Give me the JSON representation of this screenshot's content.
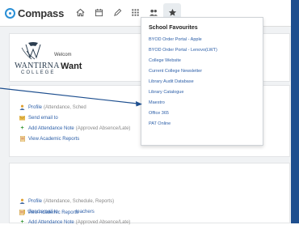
{
  "app": {
    "name": "Compass"
  },
  "nav": {
    "icons": [
      "home-icon",
      "calendar-icon",
      "pencil-icon",
      "grid-icon",
      "people-icon",
      "star-icon"
    ]
  },
  "school": {
    "name": "WANTIRNA",
    "subtitle": "COLLEGE",
    "welcome_small": "Welcom",
    "welcome_big": "Want"
  },
  "card1": {
    "links": [
      {
        "icon": "person-icon",
        "label": "Profile",
        "note": "(Attendance, Sched"
      },
      {
        "icon": "envelope-icon",
        "label": "Send email to",
        "note": ""
      },
      {
        "icon": "plus-icon",
        "label": "Add Attendance Note",
        "note": "(Approved Absence/Late)"
      },
      {
        "icon": "report-icon",
        "label": "View Academic Reports",
        "note": ""
      }
    ]
  },
  "card2": {
    "links": [
      {
        "icon": "person-icon",
        "label": "Profile",
        "note": "(Attendance, Schedule, Reports)"
      },
      {
        "icon": "envelope-icon",
        "label": "Send email to",
        "note": "teachers"
      },
      {
        "icon": "plus-icon",
        "label": "Add Attendance Note",
        "note": "(Approved Absence/Late)"
      },
      {
        "icon": "report-icon",
        "label": "View Academic Reports",
        "note": ""
      }
    ]
  },
  "favourites": {
    "title": "School Favourites",
    "items": [
      "BYOD Order Portal - Apple",
      "BYOD Order Portal - Lenovo(LWT)",
      "College Website",
      "Current College Newsletter",
      "Library Audit Database",
      "Library Catalogue",
      "Maestro",
      "Office 365",
      "PAT Online"
    ]
  },
  "colors": {
    "accent": "#2a8fd6",
    "link": "#2d5fa8",
    "border_right": "#1e4f8f"
  }
}
